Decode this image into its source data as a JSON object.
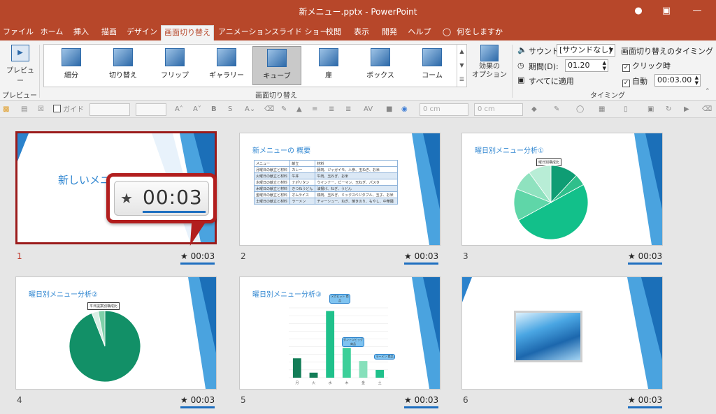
{
  "window": {
    "title": "新メニュー.pptx  -  PowerPoint"
  },
  "tabs": [
    "ファイル",
    "ホーム",
    "挿入",
    "描画",
    "デザイン",
    "画面切り替え",
    "アニメーション",
    "スライド ショー",
    "校閲",
    "表示",
    "開発",
    "ヘルプ",
    "何をしますか"
  ],
  "ribbon": {
    "preview_label": "プレビュー",
    "preview_group": "プレビュー",
    "transitions": [
      "細分",
      "切り替え",
      "フリップ",
      "ギャラリー",
      "キューブ",
      "扉",
      "ボックス",
      "コーム"
    ],
    "selected_transition": "キューブ",
    "effect_options": "効果の\nオプション",
    "transitions_group": "画面切り替え",
    "sound_label": "サウンド:",
    "sound_value": "[サウンドなし]",
    "duration_label": "期間(D):",
    "duration_value": "01.20",
    "apply_all": "すべてに適用",
    "timing_header": "画面切り替えのタイミング",
    "on_click": "クリック時",
    "after_label": "自動",
    "after_value": "00:03.00",
    "timing_group": "タイミング"
  },
  "toolbar": {
    "guide_label": "ガイド",
    "width_value": "0 cm",
    "height_value": "0 cm"
  },
  "callout": {
    "time": "00:03"
  },
  "slides": [
    {
      "number": "1",
      "title": "新しいメニュ",
      "time": "00:03"
    },
    {
      "number": "2",
      "title": "新メニューの 概要",
      "time": "00:03",
      "table": [
        [
          "メニュー",
          "献立",
          "材料"
        ],
        [
          "月曜日の献立と材料",
          "カレー",
          "豚肉、ジャガイモ、人参、玉ねぎ、お米"
        ],
        [
          "火曜日の献立と材料",
          "牛丼",
          "牛肉、玉ねぎ、お米"
        ],
        [
          "水曜日の献立と材料",
          "ナポリタン",
          "ウインナー、ピーマン、玉ねぎ、パスタ"
        ],
        [
          "木曜日の献立と材料",
          "きつねうどん",
          "油揚げ、ねぎ、うどん"
        ],
        [
          "金曜日の献立と材料",
          "オムライス",
          "鶏肉、玉ねぎ、ミックスベジタブル、玉子、お米"
        ],
        [
          "土曜日の献立と材料",
          "ラーメン",
          "チャーシュー、ねぎ、焼きのり、もやし、中華麺"
        ]
      ]
    },
    {
      "number": "3",
      "title": "曜日別メニュー分析①",
      "chart_title": "曜日別構成比",
      "time": "00:03"
    },
    {
      "number": "4",
      "title": "曜日別メニュー分析②",
      "chart_title": "平日提案別構成比",
      "time": "00:03"
    },
    {
      "number": "5",
      "title": "曜日別メニュー分析③",
      "time": "00:03",
      "callouts": [
        "メガヒット 商品",
        "ダントツビッグ 商品",
        "ラーメン 商品"
      ]
    },
    {
      "number": "6",
      "title": "",
      "time": "00:03"
    }
  ],
  "chart_data": [
    {
      "type": "pie",
      "title": "曜日別構成比",
      "values": [
        12,
        5,
        50,
        14,
        9,
        10
      ],
      "colors": [
        "#0f9d74",
        "#2fbf8b",
        "#12c08a",
        "#5fd6a8",
        "#8fe2bf",
        "#b8edd6"
      ]
    },
    {
      "type": "pie",
      "title": "平日提案別構成比",
      "values": [
        94,
        3,
        3
      ],
      "colors": [
        "#129067",
        "#d9efe5",
        "#7fd0a9"
      ]
    },
    {
      "type": "bar",
      "title": "",
      "categories": [
        "月",
        "火",
        "水",
        "木",
        "金",
        "土"
      ],
      "values": [
        500,
        130,
        1720,
        770,
        430,
        200
      ],
      "ylim": [
        0,
        1800
      ],
      "colors": [
        "#137d57",
        "#137d57",
        "#1fc18b",
        "#3ccf99",
        "#86e0bb",
        "#1fc18b"
      ]
    }
  ]
}
